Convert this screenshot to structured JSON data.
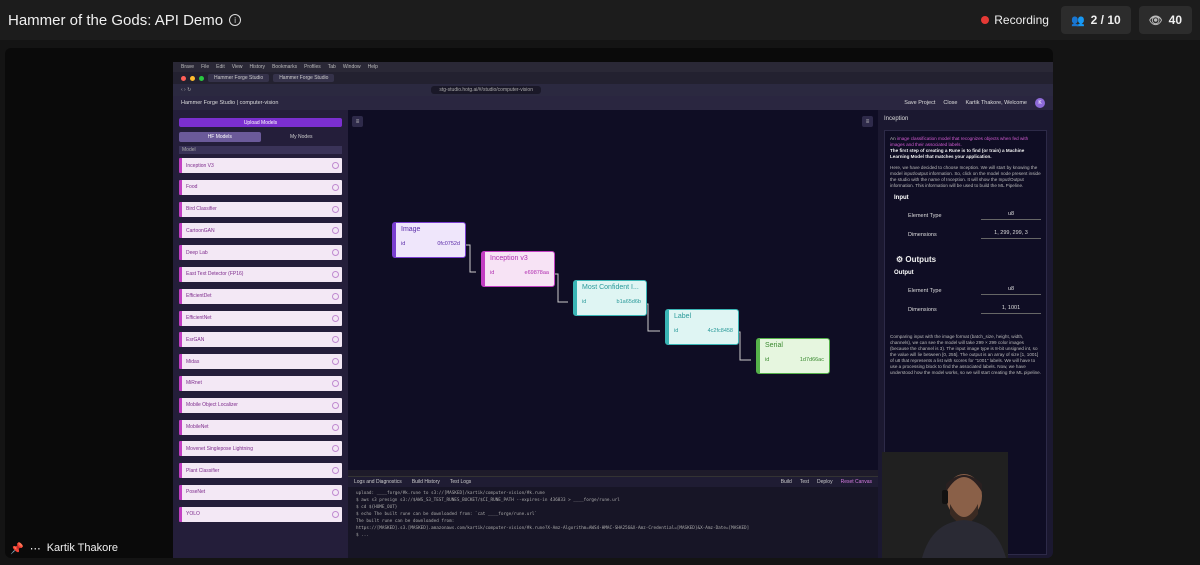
{
  "meeting": {
    "title": "Hammer of the Gods: API Demo",
    "recording_label": "Recording",
    "participants": "2 / 10",
    "viewers": "40",
    "presenter": "Kartik Thakore"
  },
  "browser": {
    "menu": [
      "Brave",
      "File",
      "Edit",
      "View",
      "History",
      "Bookmarks",
      "Profiles",
      "Tab",
      "Window",
      "Help"
    ],
    "tabs": [
      "Hammer Forge Studio",
      "Hammer Forge Studio"
    ],
    "url": "stg-studio.hotg.ai/#/studio/computer-vision"
  },
  "app": {
    "title": "Hammer Forge Studio | computer-vision",
    "save_label": "Save Project",
    "close_label": "Close",
    "welcome": "Kartik Thakore, Welcome",
    "avatar": "K"
  },
  "sidebar": {
    "upload_label": "Upload Models",
    "toggle": [
      "HF Models",
      "My Nodes"
    ],
    "section_label": "Model",
    "models": [
      "Inception V3",
      "Food",
      "Bird Classifier",
      "CartoonGAN",
      "Deep Lab",
      "East Text Detector (FP16)",
      "EfficientDet",
      "EfficientNet",
      "EsrGAN",
      "Midas",
      "MiRnet",
      "Mobile Object Localizer",
      "MobileNet",
      "Movenet Singlepose Lightning",
      "Plant Classifier",
      "PoseNet",
      "YOLO"
    ]
  },
  "nodes": [
    {
      "title": "Image",
      "id": "0fc0752d",
      "color": "#7a3fd0",
      "bg": "#efe6fb",
      "text": "#5a2aa8"
    },
    {
      "title": "Inception v3",
      "id": "e69878aa",
      "color": "#c23fc2",
      "bg": "#f7e3f5",
      "text": "#b02db0"
    },
    {
      "title": "Most Confident I...",
      "id": "b1a65d6b",
      "color": "#3ab5b5",
      "bg": "#dff5f3",
      "text": "#2a9a9a"
    },
    {
      "title": "Label",
      "id": "4c2fc8458",
      "color": "#3ab5b5",
      "bg": "#dff5f3",
      "text": "#2a9a9a"
    },
    {
      "title": "Serial",
      "id": "1d7d66ac",
      "color": "#55b14a",
      "bg": "#e6f6df",
      "text": "#3a8a30"
    }
  ],
  "logs": {
    "tabs": [
      "Logs and Diagnostics",
      "Build History",
      "Test Logs"
    ],
    "actions": [
      "Build",
      "Test",
      "Deploy",
      "Reset Canvas"
    ],
    "lines": [
      "upload: ____forge/#k.rune to s3://[MASKED]/kartik/computer-vision/#k.rune",
      "$ aws s3 presign s3://$AWS_S3_TEST_RUNES_BUCKET/$CI_RUNE_PATH --expires-in 436833 > ____forge/rune.url",
      "$ cd ${HOME_OUT}",
      "$ echo The built rune can be downloaded from: `cat ____forge/rune.url`",
      "The built rune can be downloaded from:",
      "https://[MASKED].s3.[MASKED].amazonaws.com/kartik/computer-vision/#k.rune?X-Amz-Algorithm=AWS4-HMAC-SHA256&X-Amz-Credential=[MASKED]&X-Amz-Date=[MASKED]",
      "$ ..."
    ]
  },
  "right_panel": {
    "heading": "Inception",
    "intro_highlight": "image classification model that recognizes objects when fed with images and their associated labels.",
    "intro_prefix": "An ",
    "intro_bold": "The first step of creating a Rune is to find (or train) a Machine Learning Model that matches your application.",
    "body": "Here, we have decided to choose Inception. We will start by knowing the model input/output information. So, click on the model node present inside the studio with the name of Inception. It will show the Input/Output information. This information will be used to build the ML Pipeline.",
    "input_title": "Input",
    "output_title": "Output",
    "outputs_heading": "Outputs",
    "element_type_label": "Element Type",
    "dimensions_label": "Dimensions",
    "input_type": "u8",
    "input_dims": "1, 299, 299, 3",
    "output_type": "u8",
    "output_dims": "1, 1001",
    "footer": "Comparing input with the image format (batch_size, height, width, channels), we can see the model will take 299 × 299 color images (because the channel is 3). The input image type is 8-bit unsigned int, so the value will lie between [0, 255]. The output is an array of size [1, 1001] of u8 that represents a list with scores for \"1001\" labels. We will have to use a processing block to find the associated labels. Now, we have understood how the model works, so we will start creating the ML pipeline."
  }
}
